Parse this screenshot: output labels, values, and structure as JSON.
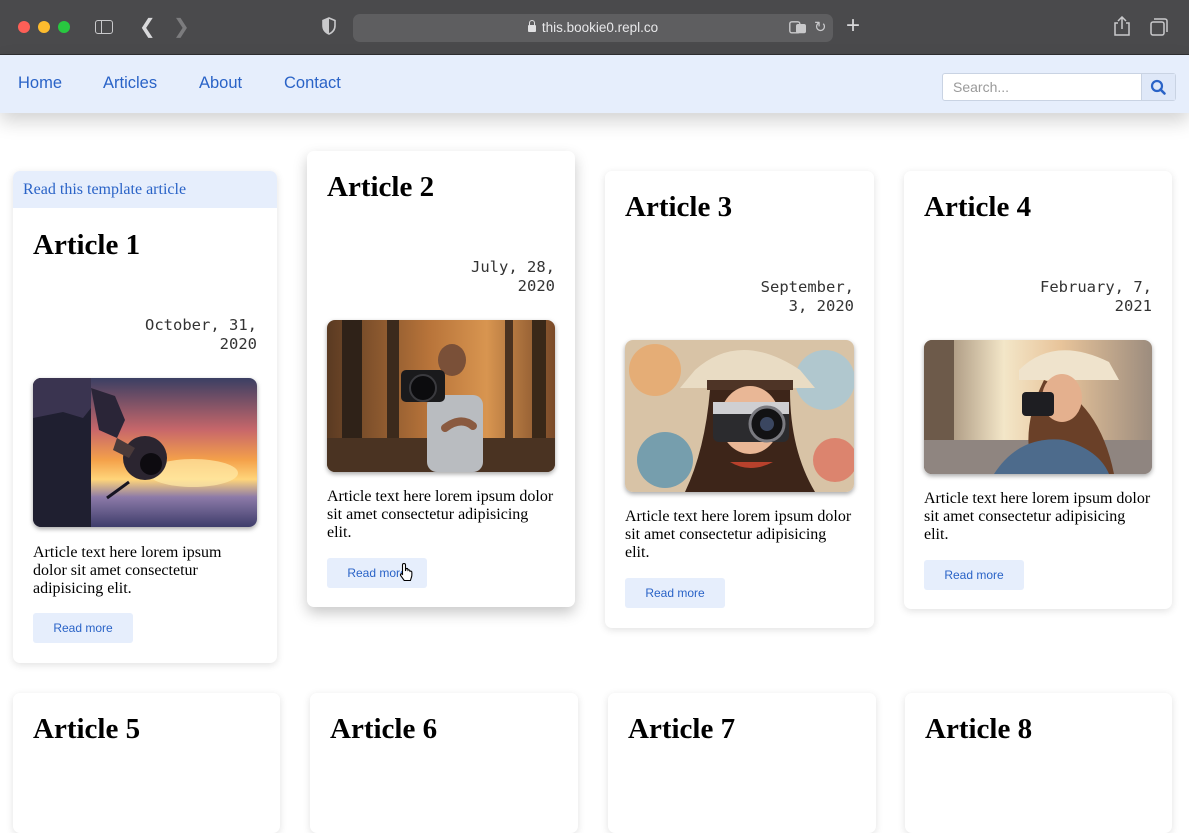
{
  "browser": {
    "url": "this.bookie0.repl.co"
  },
  "nav": {
    "links": [
      "Home",
      "Articles",
      "About",
      "Contact"
    ],
    "search_placeholder": "Search...",
    "search_icon": "magnifier-icon"
  },
  "articles": [
    {
      "banner": "Read this template article",
      "title": "Article 1",
      "date_line1": "October, 31,",
      "date_line2": "2020",
      "text": "Article text here lorem ipsum dolor sit amet consectetur adipisicing elit.",
      "button": "Read more",
      "photo": "sunset-camera-photo"
    },
    {
      "title": "Article 2",
      "date_line1": "July, 28,",
      "date_line2": "2020",
      "text": "Article text here lorem ipsum dolor sit amet consectetur adipisicing elit.",
      "button": "Read more",
      "photo": "forest-camera-toss-photo"
    },
    {
      "title": "Article 3",
      "date_line1": "September,",
      "date_line2": "3, 2020",
      "text": "Article text here lorem ipsum dolor sit amet consectetur adipisicing elit.",
      "button": "Read more",
      "photo": "woman-hat-camera-photo"
    },
    {
      "title": "Article 4",
      "date_line1": "February, 7,",
      "date_line2": "2021",
      "text": "Article text here lorem ipsum dolor sit amet consectetur adipisicing elit.",
      "button": "Read more",
      "photo": "street-woman-camera-photo"
    },
    {
      "title": "Article 5"
    },
    {
      "title": "Article 6"
    },
    {
      "title": "Article 7"
    },
    {
      "title": "Article 8"
    }
  ],
  "colors": {
    "nav_bg": "#e6eefc",
    "link": "#2a63c7",
    "chrome": "#4a4a4c"
  }
}
